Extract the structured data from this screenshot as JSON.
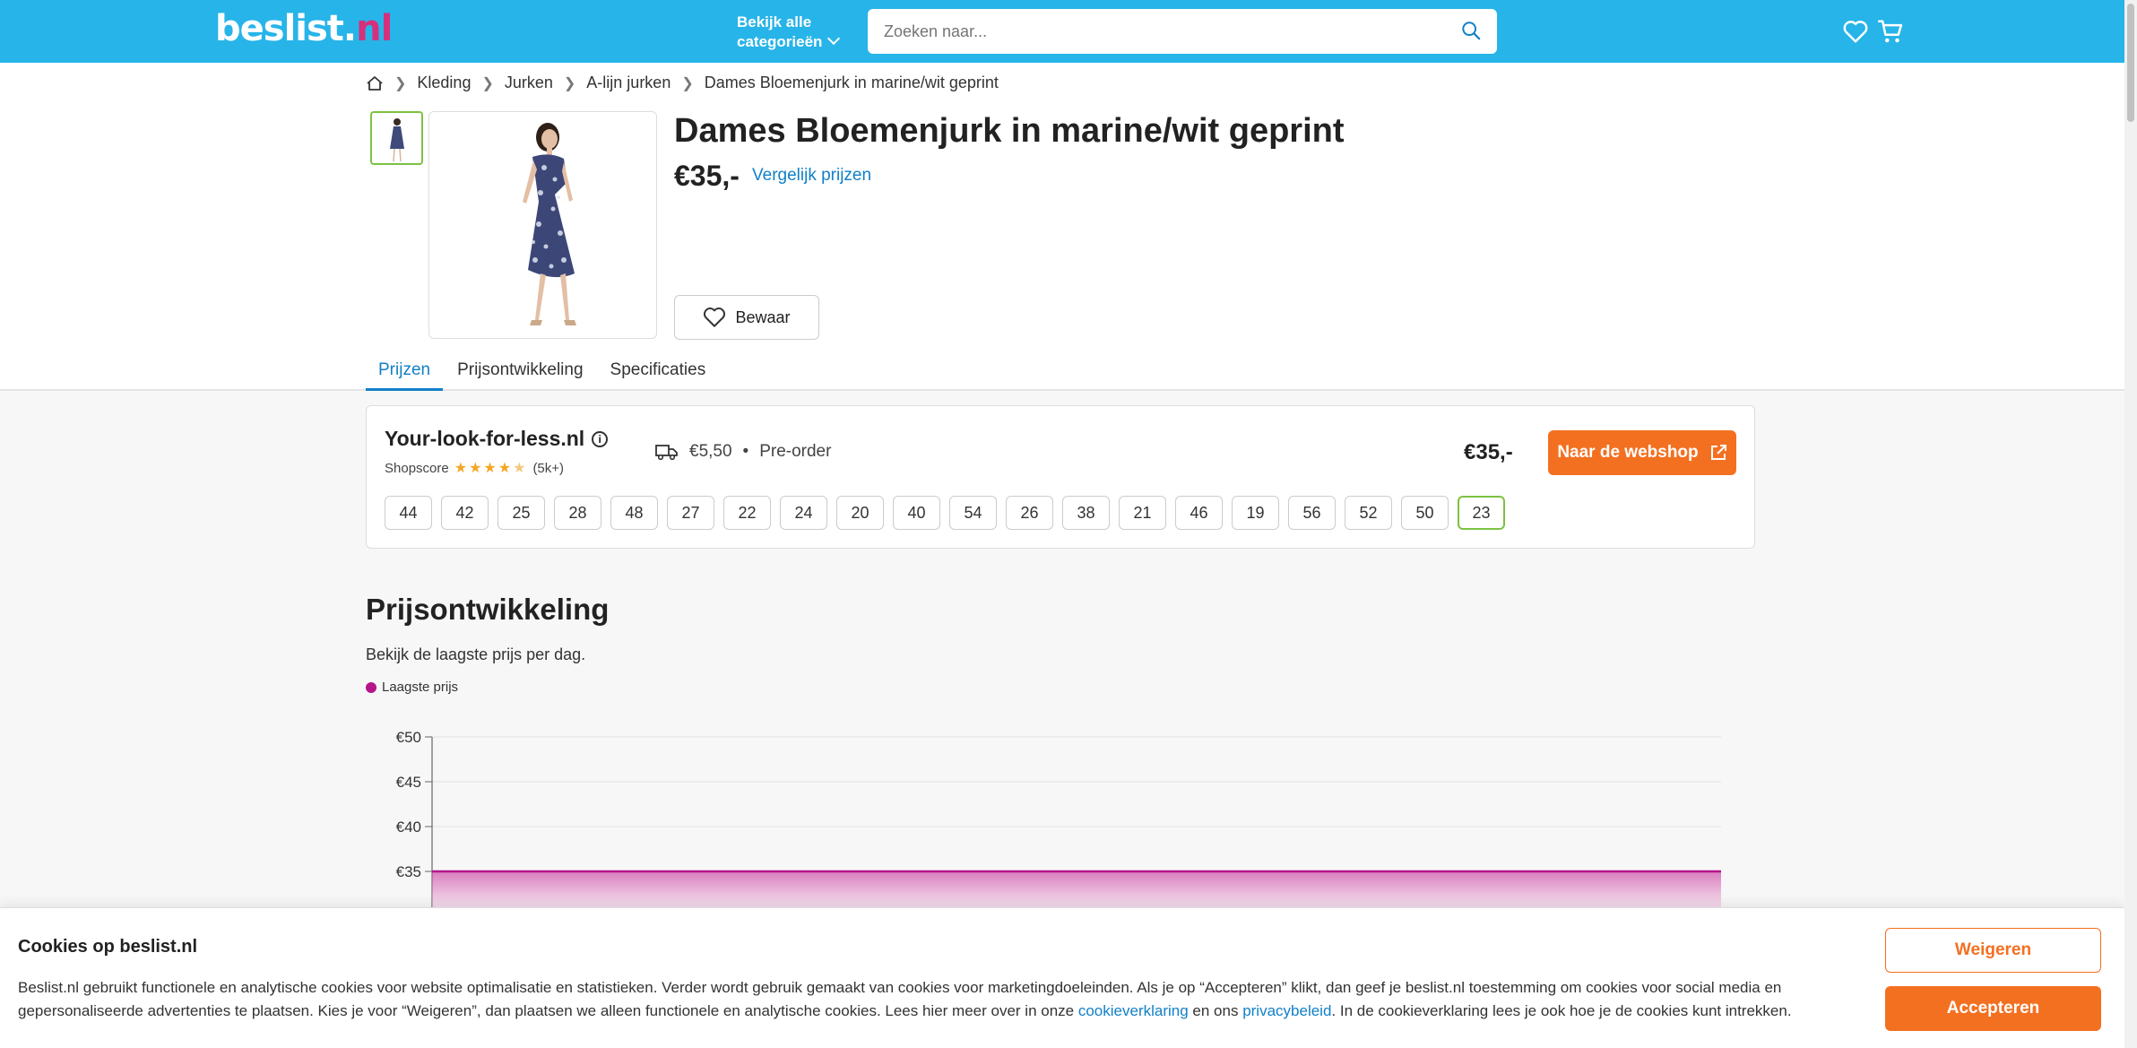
{
  "header": {
    "logo_main": "beslist",
    "logo_dot": ".",
    "logo_tld": "nl",
    "categories_line1": "Bekijk alle",
    "categories_line2": "categorieën",
    "search_placeholder": "Zoeken naar..."
  },
  "breadcrumb": {
    "items": [
      "Kleding",
      "Jurken",
      "A-lijn jurken",
      "Dames Bloemenjurk in marine/wit geprint"
    ]
  },
  "product": {
    "title": "Dames Bloemenjurk in marine/wit geprint",
    "price": "€35,-",
    "compare_label": "Vergelijk prijzen",
    "save_label": "Bewaar"
  },
  "tabs": [
    {
      "label": "Prijzen",
      "active": true
    },
    {
      "label": "Prijsontwikkeling",
      "active": false
    },
    {
      "label": "Specificaties",
      "active": false
    }
  ],
  "offer": {
    "shop_name": "Your-look-for-less.nl",
    "shopscore_label": "Shopscore",
    "rating": 4.5,
    "rating_count": "(5k+)",
    "shipping": "€5,50",
    "separator": "•",
    "availability": "Pre-order",
    "price": "€35,-",
    "button_label": "Naar de webshop",
    "sizes": [
      "44",
      "42",
      "25",
      "28",
      "48",
      "27",
      "22",
      "24",
      "20",
      "40",
      "54",
      "26",
      "38",
      "21",
      "46",
      "19",
      "56",
      "52",
      "50",
      "23"
    ],
    "selected_size": "23"
  },
  "price_history": {
    "title": "Prijsontwikkeling",
    "subtitle": "Bekijk de laagste prijs per dag.",
    "legend": "Laagste prijs"
  },
  "chart_data": {
    "type": "area",
    "series": [
      {
        "name": "Laagste prijs",
        "values": [
          35,
          35
        ]
      }
    ],
    "y_ticks": [
      "€50",
      "€45",
      "€40",
      "€35"
    ],
    "y_tick_values": [
      50,
      45,
      40,
      35
    ],
    "ylim": [
      30,
      50
    ],
    "grid": true,
    "line_color": "#b5168a"
  },
  "cookie": {
    "title": "Cookies op beslist.nl",
    "text_part1": "Beslist.nl gebruikt functionele en analytische cookies voor website optimalisatie en statistieken. Verder wordt gebruik gemaakt van cookies voor marketingdoeleinden. Als je op “Accepteren” klikt, dan geef je beslist.nl toestemming om cookies voor social media en gepersonaliseerde advertenties te plaatsen. Kies je voor “Weigeren”, dan plaatsen we alleen functionele en analytische cookies. Lees hier meer over in onze ",
    "link1": "cookieverklaring",
    "text_part2": " en ons ",
    "link2": "privacybeleid",
    "text_part3": ". In de cookieverklaring lees je ook hoe je de cookies kunt intrekken.",
    "deny_label": "Weigeren",
    "accept_label": "Accepteren"
  },
  "colors": {
    "brand_blue": "#27b4e9",
    "accent_orange": "#f37021",
    "link_blue": "#1180c8",
    "chart_magenta": "#b5168a",
    "selected_green": "#7cc242"
  }
}
